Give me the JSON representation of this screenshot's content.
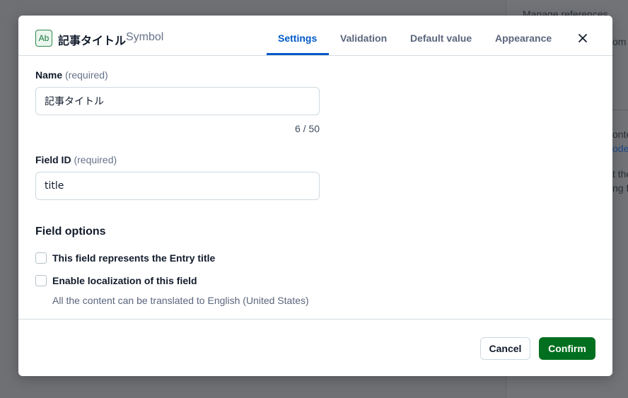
{
  "background": {
    "panel_heading": "Manage references",
    "snippet_1": "om a",
    "snippet_2": "onte",
    "snippet_3": "ode",
    "snippet_4": "t the",
    "snippet_5": "ng f"
  },
  "modal": {
    "type_icon_text": "Ab",
    "title": "記事タイトル",
    "subtitle": "Symbol",
    "tabs": [
      {
        "label": "Settings",
        "active": true
      },
      {
        "label": "Validation",
        "active": false
      },
      {
        "label": "Default value",
        "active": false
      },
      {
        "label": "Appearance",
        "active": false
      }
    ],
    "close_icon": "close-icon"
  },
  "form": {
    "name": {
      "label": "Name",
      "required_text": "(required)",
      "value": "記事タイトル",
      "counter": "6 / 50"
    },
    "field_id": {
      "label": "Field ID",
      "required_text": "(required)",
      "value": "title"
    },
    "field_options": {
      "title": "Field options",
      "options": [
        {
          "label": "This field represents the Entry title",
          "checked": false
        },
        {
          "label": "Enable localization of this field",
          "checked": false,
          "help": "All the content can be translated to English (United States)"
        }
      ]
    }
  },
  "footer": {
    "cancel_label": "Cancel",
    "confirm_label": "Confirm"
  },
  "colors": {
    "accent": "#0059c8",
    "confirm": "#006f1f",
    "overlay": "#6e7074"
  }
}
